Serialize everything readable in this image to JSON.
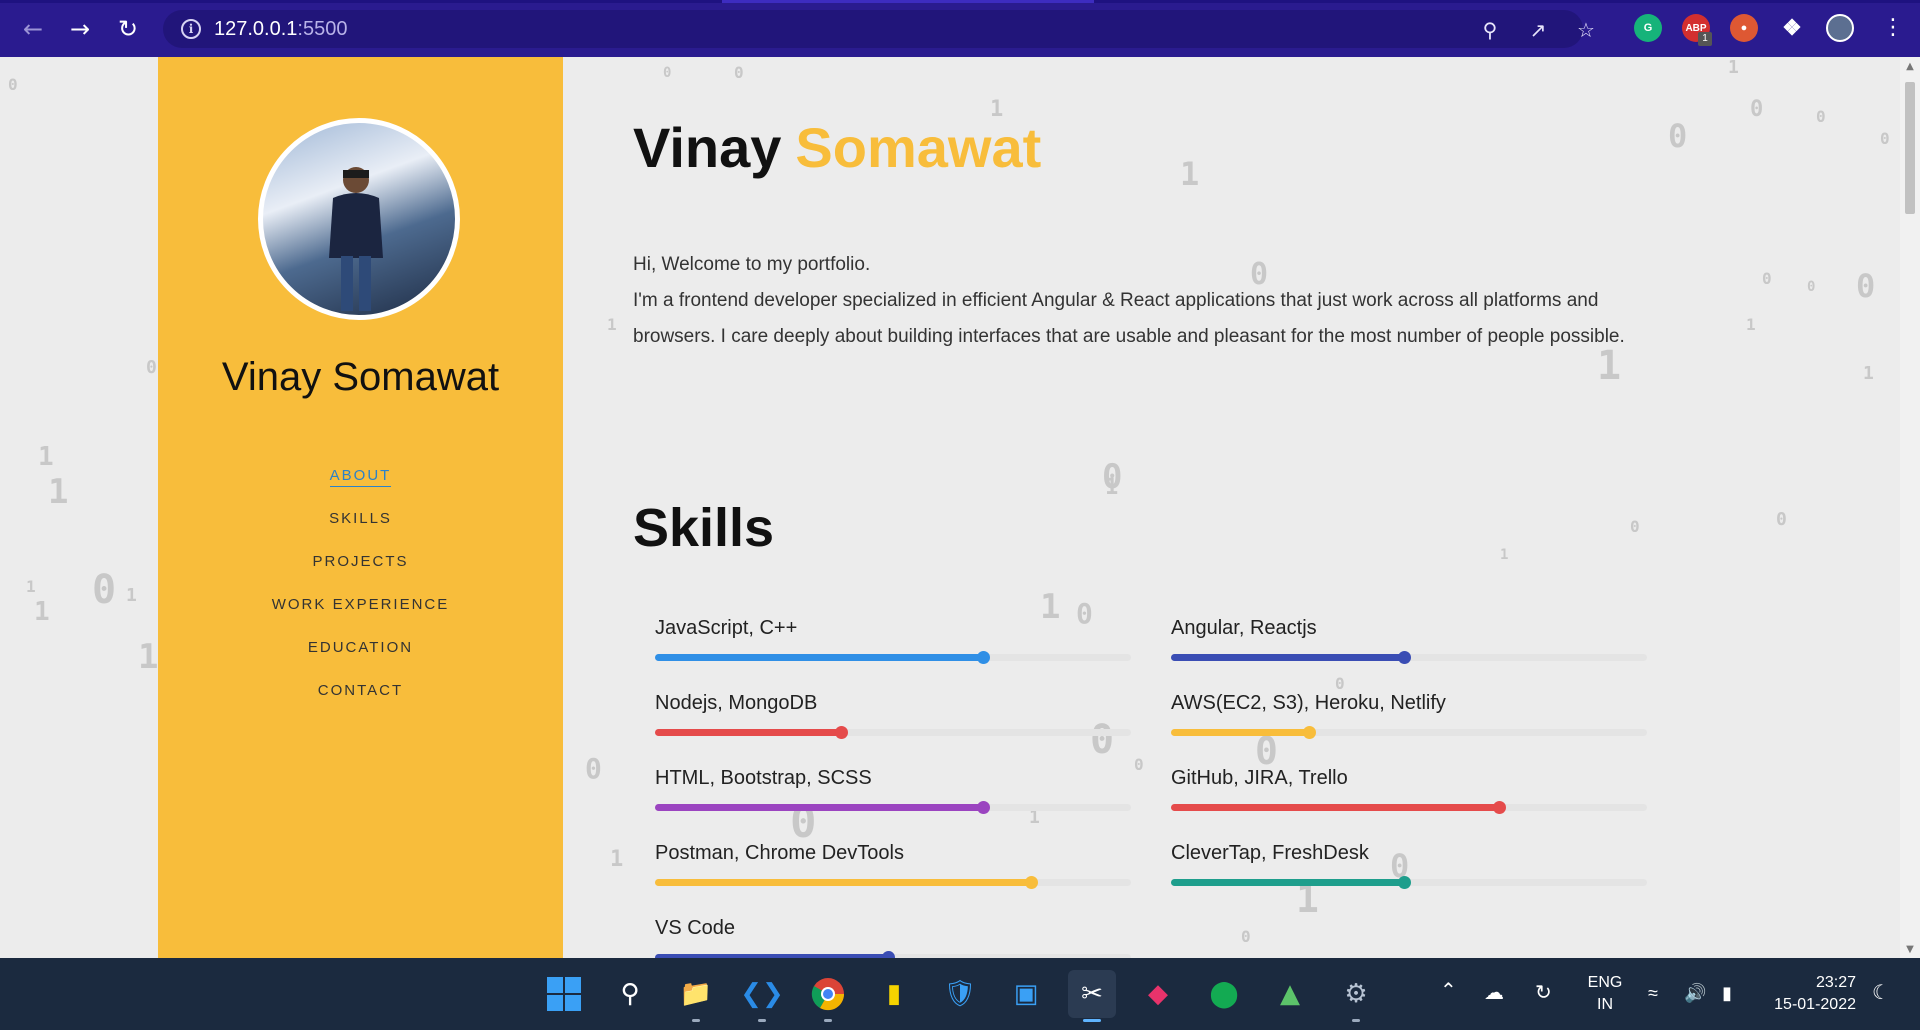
{
  "browser": {
    "url_host": "127.0.0.1",
    "url_port": ":5500",
    "ext_abp_badge": "1",
    "ext_abp_label": "ABP"
  },
  "sidebar": {
    "name": "Vinay Somawat",
    "nav": [
      "ABOUT",
      "SKILLS",
      "PROJECTS",
      "WORK EXPERIENCE",
      "EDUCATION",
      "CONTACT"
    ],
    "active_index": 0
  },
  "hero": {
    "first_name": "Vinay",
    "last_name": "Somawat",
    "accent_color": "#f8bd3b"
  },
  "intro": {
    "line1": "Hi, Welcome to my portfolio.",
    "line2": "I'm a frontend developer specialized in efficient Angular & React applications that just work across all platforms and browsers. I care deeply about building interfaces that are usable and pleasant for the most number of people possible."
  },
  "skills": {
    "title": "Skills",
    "items": [
      {
        "label": "JavaScript, C++",
        "level": 0.69,
        "color": "#2f8fe6"
      },
      {
        "label": "Angular, Reactjs",
        "level": 0.49,
        "color": "#3a4db4"
      },
      {
        "label": "Nodejs, MongoDB",
        "level": 0.39,
        "color": "#e54b4b"
      },
      {
        "label": "AWS(EC2, S3), Heroku, Netlify",
        "level": 0.29,
        "color": "#f8bd3b"
      },
      {
        "label": "HTML, Bootstrap, SCSS",
        "level": 0.69,
        "color": "#9b44c0"
      },
      {
        "label": "GitHub, JIRA, Trello",
        "level": 0.69,
        "color": "#e54b4b"
      },
      {
        "label": "Postman, Chrome DevTools",
        "level": 0.79,
        "color": "#f8bd3b"
      },
      {
        "label": "CleverTap, FreshDesk",
        "level": 0.49,
        "color": "#1e9e8c"
      },
      {
        "label": "VS Code",
        "level": 0.49,
        "color": "#3a4db4"
      }
    ]
  },
  "taskbar": {
    "lang_top": "ENG",
    "lang_bottom": "IN",
    "time": "23:27",
    "date": "15-01-2022"
  }
}
